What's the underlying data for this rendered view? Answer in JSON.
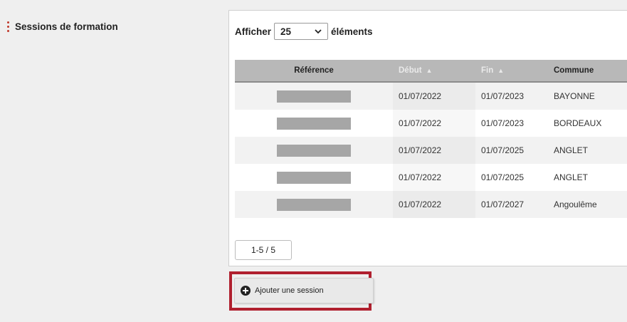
{
  "section": {
    "label": "Sessions de formation"
  },
  "length": {
    "prefix": "Afficher",
    "selected": "25",
    "suffix": "éléments"
  },
  "table": {
    "columns": [
      {
        "label": "Référence",
        "sorted": false
      },
      {
        "label": "Début",
        "sorted": true,
        "arrow": "▲"
      },
      {
        "label": "Fin",
        "sorted": true,
        "arrow": "▲"
      },
      {
        "label": "Commune",
        "sorted": false
      }
    ],
    "rows": [
      {
        "debut": "01/07/2022",
        "fin": "01/07/2023",
        "commune": "BAYONNE"
      },
      {
        "debut": "01/07/2022",
        "fin": "01/07/2023",
        "commune": "BORDEAUX"
      },
      {
        "debut": "01/07/2022",
        "fin": "01/07/2025",
        "commune": "ANGLET"
      },
      {
        "debut": "01/07/2022",
        "fin": "01/07/2025",
        "commune": "ANGLET"
      },
      {
        "debut": "01/07/2022",
        "fin": "01/07/2027",
        "commune": "Angoulême"
      }
    ]
  },
  "pagination": {
    "info": "1-5 / 5"
  },
  "add_button": {
    "label": "Ajouter une session",
    "icon": "plus-circle-icon"
  },
  "colors": {
    "required_marker": "#c0392b",
    "highlight_border": "#b0202f",
    "header_bg": "#b8b8b8"
  }
}
